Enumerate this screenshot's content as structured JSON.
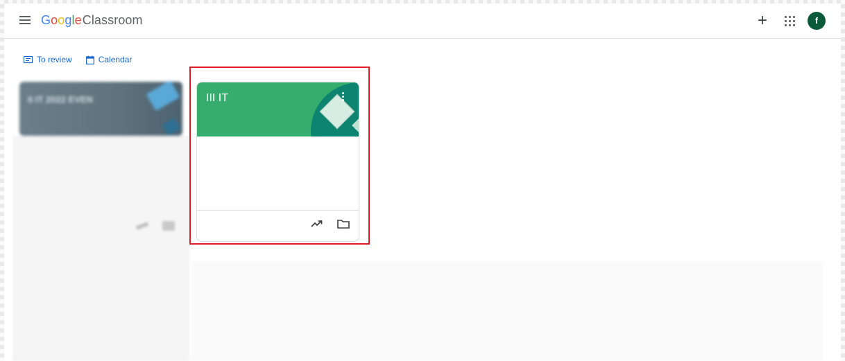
{
  "header": {
    "logo_google": [
      "G",
      "o",
      "o",
      "g",
      "l",
      "e"
    ],
    "logo_product": "Classroom",
    "add_button": "+",
    "avatar_initial": "f"
  },
  "subnav": {
    "to_review": "To review",
    "calendar": "Calendar"
  },
  "classes": [
    {
      "title": "II IT 2022 EVEN",
      "blurred": true
    },
    {
      "title": "III IT",
      "header_color": "#36ad6c",
      "accent_color": "#0d8470"
    }
  ],
  "colors": {
    "link_blue": "#1967d2",
    "avatar_bg": "#0b5a3a",
    "highlight_red": "#e01b24"
  }
}
